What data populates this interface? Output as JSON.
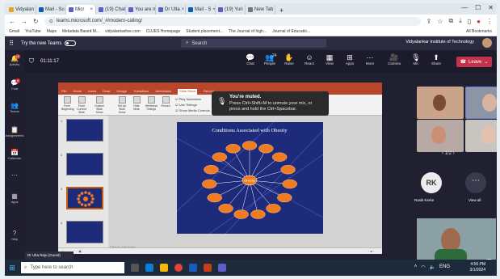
{
  "browser": {
    "tabs": [
      {
        "label": "Vidyalan",
        "color": "#e8a317",
        "active": false
      },
      {
        "label": "Mail - Su",
        "color": "#0b5cad",
        "active": false
      },
      {
        "label": "Micr",
        "color": "#5b5fc7",
        "active": true
      },
      {
        "label": "(19) Chat",
        "color": "#5b5fc7",
        "active": false
      },
      {
        "label": "You are n",
        "color": "#5b5fc7",
        "active": false
      },
      {
        "label": "Dr Ulta",
        "color": "#5b5fc7",
        "active": false
      },
      {
        "label": "Mail - S",
        "color": "#0b5cad",
        "active": false
      },
      {
        "label": "(19) Yuri",
        "color": "#5b5fc7",
        "active": false
      },
      {
        "label": "New Tab",
        "color": "#777777",
        "active": false
      }
    ],
    "new_tab": "+",
    "url": "teams.microsoft.com/_#/modern-calling/",
    "bookmarks": [
      "Gmail",
      "YouTube",
      "Maps",
      "Metadata Based M...",
      "vidyalankarlive.com",
      "CLUES Homepage",
      "Student placement...",
      "The Journal of high...",
      "Journal of Educatio..."
    ],
    "all_bookmarks": "All Bookmarks"
  },
  "teams": {
    "try_new": "Try the new Teams",
    "search_placeholder": "Search",
    "org_name": "Vidyalankar Institute of Technology",
    "rail": [
      {
        "label": "Activity",
        "icon": "🔔",
        "badge": "10"
      },
      {
        "label": "Chat",
        "icon": "💬",
        "badge": "4"
      },
      {
        "label": "Teams",
        "icon": "👥",
        "badge": ""
      },
      {
        "label": "Assignments",
        "icon": "📋",
        "badge": ""
      },
      {
        "label": "Calendar",
        "icon": "📅",
        "badge": ""
      },
      {
        "label": "",
        "icon": "⋯",
        "badge": ""
      },
      {
        "label": "Apps",
        "icon": "▦",
        "badge": ""
      },
      {
        "label": "Help",
        "icon": "?",
        "badge": ""
      }
    ],
    "meeting": {
      "timer": "01:11:17",
      "controls": [
        {
          "label": "Chat",
          "icon": "💬"
        },
        {
          "label": "People",
          "icon": "👥",
          "count": "24"
        },
        {
          "label": "Raise",
          "icon": "✋"
        },
        {
          "label": "React",
          "icon": "☺"
        },
        {
          "label": "View",
          "icon": "▦"
        },
        {
          "label": "Apps",
          "icon": "⊞"
        },
        {
          "label": "More",
          "icon": "⋯"
        },
        {
          "label": "Camera",
          "icon": "🎥"
        },
        {
          "label": "Mic",
          "icon": "🎙"
        },
        {
          "label": "Share",
          "icon": "⬆"
        }
      ],
      "leave": "Leave"
    },
    "toast": {
      "title": "You're muted.",
      "body": "Press Ctrl+Shift+M to unmute your mic, or press and hold the Ctrl+Spacebar."
    },
    "presenter_label": "Dr Ulta Reju (Guest)",
    "pager": "1/2",
    "participant_initials": "RK",
    "participant_name": "Rasik Kerke",
    "view_all": "View all"
  },
  "powerpoint": {
    "tabs": [
      "File",
      "Home",
      "Insert",
      "Draw",
      "Design",
      "Transitions",
      "Animations",
      "Slide Show",
      "Record"
    ],
    "active_tab": "Slide Show",
    "ribbon_buttons": [
      "From Beginning",
      "From Current Slide",
      "Custom Slide Show",
      "Set Up Slide Show",
      "Hide Slide",
      "Rehearse Timings",
      "Record"
    ],
    "checkboxes": [
      "Play Narrations",
      "Use Timings",
      "Show Media Controls"
    ],
    "notes_placeholder": "Click to add notes",
    "slide_numbers": [
      "1",
      "2",
      "3",
      "4"
    ],
    "slide": {
      "title": "Conditions Associated with Obesity",
      "center": "Obesity",
      "nodes": [
        "",
        "",
        "",
        "",
        "",
        "",
        "",
        "",
        "",
        "",
        "",
        "",
        "",
        "",
        ""
      ]
    }
  },
  "taskbar": {
    "search_placeholder": "Type here to search",
    "time": "4:56 PM",
    "date": "3/1/2024",
    "weather": "ENG"
  },
  "colors": {
    "teams_dark": "#2b2b40",
    "leave_red": "#c4314b",
    "ppt_red": "#b7472a",
    "slide_blue": "#1e2a7a",
    "node_orange": "#f07c22"
  }
}
